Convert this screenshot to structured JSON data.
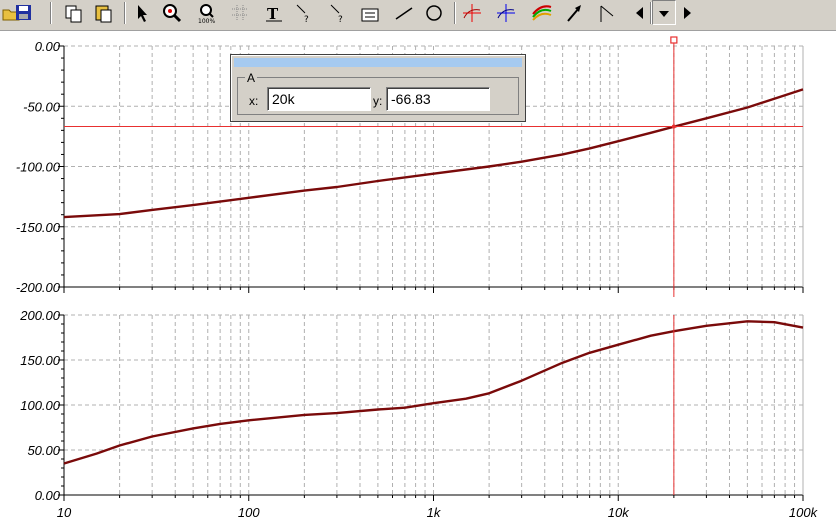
{
  "cursor": {
    "name": "A",
    "x_label": "x:",
    "x_value": "20k",
    "y_label": "y:",
    "y_value": "-66.83",
    "x_data": 20000,
    "y_data": -66.83
  },
  "colors": {
    "curve": "#7a0a0a",
    "cursor": "#e83030",
    "grid": "#b0b0b0",
    "axis": "#000000",
    "toolbar_bg": "#d4d0c8"
  },
  "toolbar": {
    "icons": [
      "open-icon",
      "save-icon",
      "copy-icon",
      "paste-icon",
      "pointer-icon",
      "zoom-icon",
      "zoom-100-icon",
      "grid-icon",
      "text-icon",
      "label-icon",
      "help-label-icon",
      "note-icon",
      "line-icon",
      "ellipse-icon",
      "cursor-a-icon",
      "cursor-b-icon",
      "curves-icon",
      "arrow-tool-icon",
      "arrow-tool2-icon",
      "scroll-left-icon",
      "dropdown-icon",
      "scroll-right-icon"
    ]
  },
  "chart_data": [
    {
      "type": "line",
      "x_scale": "log",
      "xlim": [
        10,
        100000
      ],
      "ylim": [
        -200,
        0
      ],
      "y_ticks": [
        "0.00",
        "-50.00",
        "-100.00",
        "-150.00",
        "-200.00"
      ],
      "grid": true,
      "series": [
        {
          "x": [
            10,
            20,
            30,
            50,
            100,
            200,
            300,
            500,
            1000,
            2000,
            3000,
            5000,
            7000,
            10000,
            15000,
            20000,
            30000,
            50000,
            100000
          ],
          "y": [
            -142,
            -139.5,
            -136,
            -132,
            -126,
            -120,
            -117,
            -112,
            -106,
            -100,
            -96,
            -90,
            -85,
            -79,
            -72,
            -67,
            -60,
            -51,
            -36
          ]
        }
      ]
    },
    {
      "type": "line",
      "x_scale": "log",
      "xlim": [
        10,
        100000
      ],
      "ylim": [
        0,
        200
      ],
      "y_ticks": [
        "200.00",
        "150.00",
        "100.00",
        "50.00",
        "0.00"
      ],
      "x_ticks": [
        "10",
        "100",
        "1k",
        "10k",
        "100k"
      ],
      "grid": true,
      "series": [
        {
          "x": [
            10,
            15,
            20,
            30,
            50,
            70,
            100,
            200,
            300,
            500,
            700,
            1000,
            1500,
            2000,
            3000,
            5000,
            7000,
            10000,
            15000,
            20000,
            30000,
            50000,
            70000,
            100000
          ],
          "y": [
            35,
            46,
            55,
            65,
            74,
            79,
            83,
            89,
            91,
            95,
            97,
            102,
            107,
            113,
            127,
            147,
            158,
            167,
            177,
            182,
            188,
            193,
            192,
            186
          ]
        }
      ]
    }
  ]
}
